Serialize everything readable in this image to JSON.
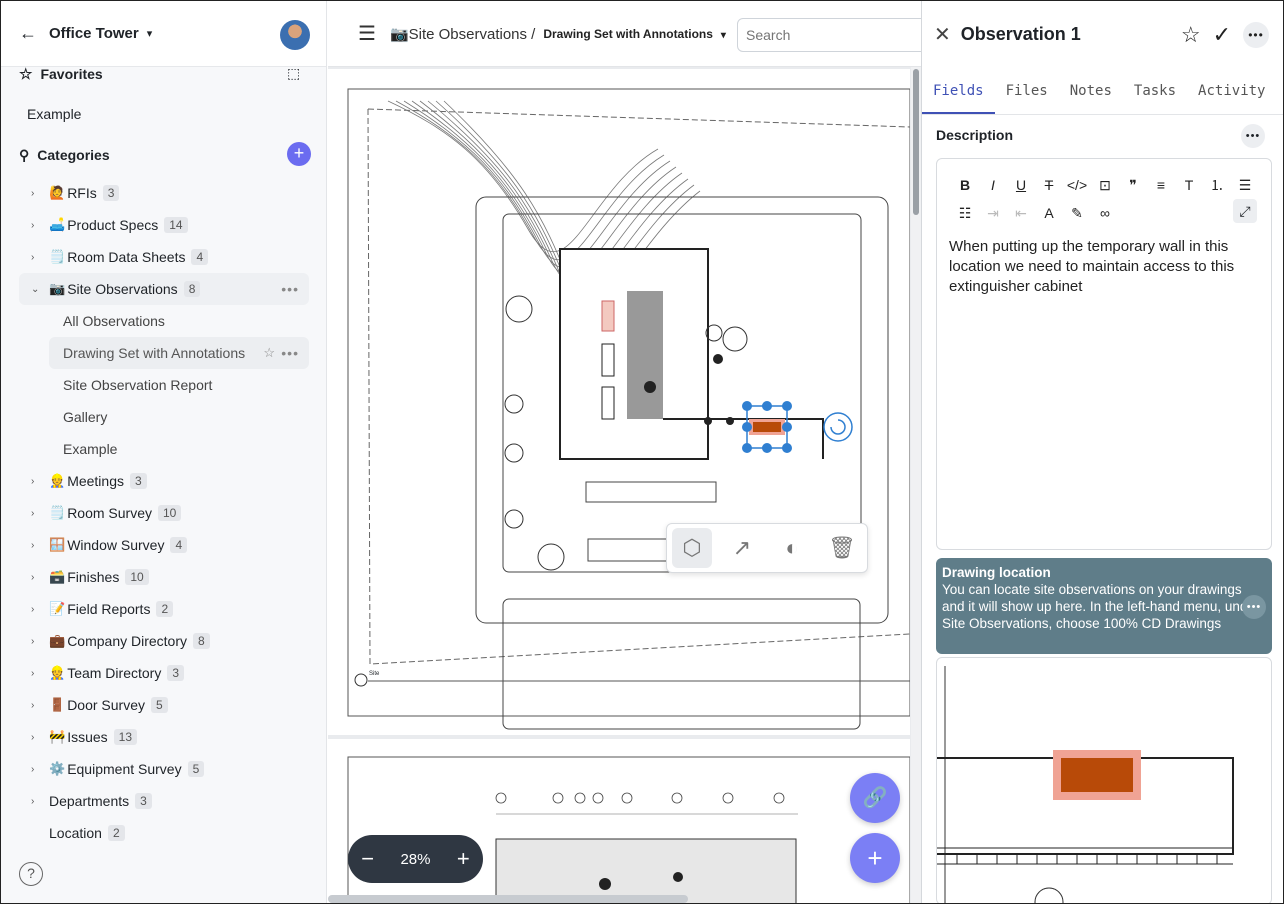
{
  "sidebar": {
    "project": "Office Tower",
    "favorites_label": "Favorites",
    "favorite_items": [
      "Example"
    ],
    "categories_label": "Categories",
    "tree": [
      {
        "emoji": "🙋",
        "label": "RFIs",
        "count": "3"
      },
      {
        "emoji": "🛋️",
        "label": "Product Specs",
        "count": "14"
      },
      {
        "emoji": "🗒️",
        "label": "Room Data Sheets",
        "count": "4"
      },
      {
        "emoji": "📷",
        "label": "Site Observations",
        "count": "8"
      },
      {
        "emoji": "👷",
        "label": "Meetings",
        "count": "3"
      },
      {
        "emoji": "🗒️",
        "label": "Room Survey",
        "count": "10"
      },
      {
        "emoji": "🪟",
        "label": "Window Survey",
        "count": "4"
      },
      {
        "emoji": "🗃️",
        "label": "Finishes",
        "count": "10"
      },
      {
        "emoji": "📝",
        "label": "Field Reports",
        "count": "2"
      },
      {
        "emoji": "💼",
        "label": "Company Directory",
        "count": "8"
      },
      {
        "emoji": "👷",
        "label": "Team Directory",
        "count": "3"
      },
      {
        "emoji": "🚪",
        "label": "Door Survey",
        "count": "5"
      },
      {
        "emoji": "🚧",
        "label": "Issues",
        "count": "13"
      },
      {
        "emoji": "⚙️",
        "label": "Equipment Survey",
        "count": "5"
      },
      {
        "emoji": "",
        "label": "Departments",
        "count": "3"
      },
      {
        "emoji": "",
        "label": "Location",
        "count": "2"
      }
    ],
    "site_obs_children": [
      "All Observations",
      "Drawing Set with Annotations",
      "Site Observation Report",
      "Gallery",
      "Example"
    ]
  },
  "main": {
    "crumb_parent": "📷Site Observations /",
    "crumb_current": "Drawing Set with Annotations",
    "search_placeholder": "Search",
    "zoom_level": "28%",
    "drawing_site_label": "Site"
  },
  "panel": {
    "title": "Observation 1",
    "tabs": [
      "Fields",
      "Files",
      "Notes",
      "Tasks",
      "Activity"
    ],
    "description_label": "Description",
    "description_text": "When putting up the temporary wall in this location we need to maintain access to this extinguisher cabinet",
    "location_title": "Drawing location",
    "location_text": "You can locate site observations on your drawings and it will show up here. In the left-hand menu, under Site Observations, choose 100% CD Drawings"
  },
  "colors": {
    "accent": "#6b6cf0",
    "marker": "#b84a08",
    "marker_halo": "#f0a394",
    "handle": "#2f7fd1",
    "location_bg": "#5f7d89"
  }
}
